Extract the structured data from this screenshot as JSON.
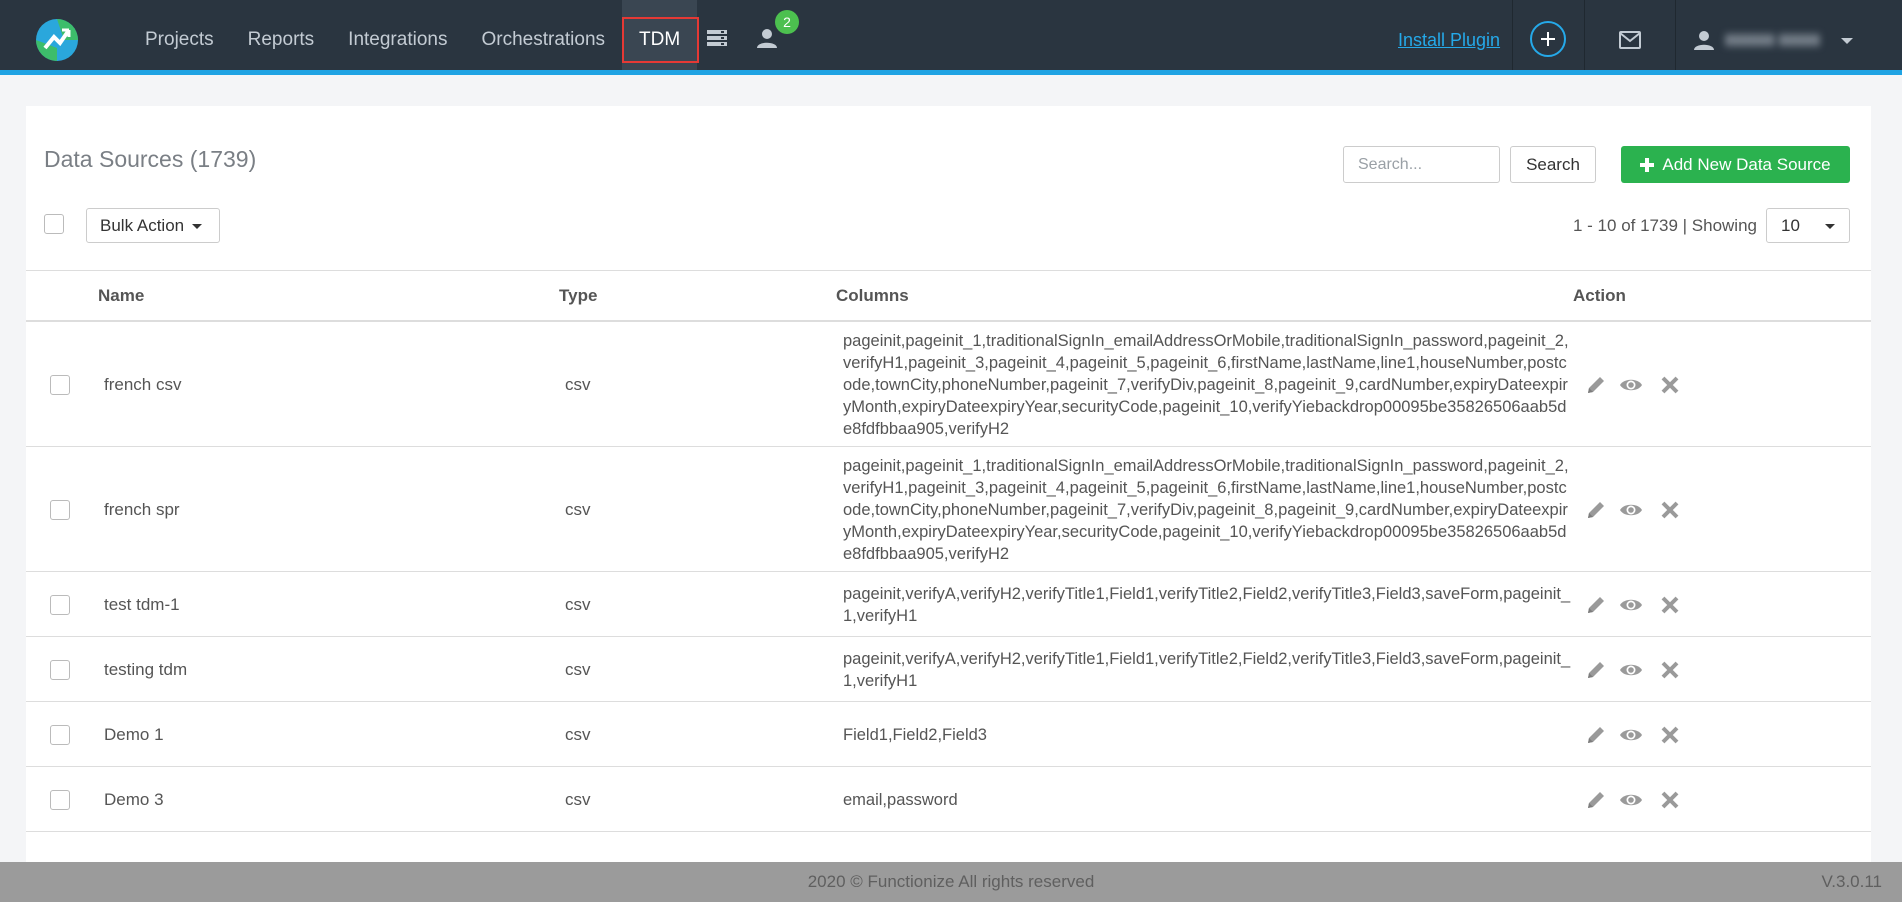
{
  "nav": {
    "links": [
      "Projects",
      "Reports",
      "Integrations",
      "Orchestrations",
      "TDM"
    ],
    "notification_count": "2",
    "install_plugin": "Install Plugin",
    "accent_color": "#1fa3e3",
    "highlight_color": "#e53935"
  },
  "main": {
    "title": "Data Sources (1739)",
    "search_placeholder": "Search...",
    "search_button": "Search",
    "add_button": "Add New Data Source",
    "bulk_action": "Bulk Action",
    "paging": "1 - 10 of 1739 | Showing",
    "page_size": "10"
  },
  "table": {
    "headers": [
      "Name",
      "Type",
      "Columns",
      "Action"
    ],
    "rows": [
      {
        "name": "french csv",
        "type": "csv",
        "columns": "pageinit,pageinit_1,traditionalSignIn_emailAddressOrMobile,traditionalSignIn_password,pageinit_2,verifyH1,pageinit_3,pageinit_4,pageinit_5,pageinit_6,firstName,lastName,line1,houseNumber,postcode,townCity,phoneNumber,pageinit_7,verifyDiv,pageinit_8,pageinit_9,cardNumber,expiryDateexpiryMonth,expiryDateexpiryYear,securityCode,pageinit_10,verifyYiebackdrop00095be35826506aab5de8fdfbbaa905,verifyH2"
      },
      {
        "name": "french spr",
        "type": "csv",
        "columns": "pageinit,pageinit_1,traditionalSignIn_emailAddressOrMobile,traditionalSignIn_password,pageinit_2,verifyH1,pageinit_3,pageinit_4,pageinit_5,pageinit_6,firstName,lastName,line1,houseNumber,postcode,townCity,phoneNumber,pageinit_7,verifyDiv,pageinit_8,pageinit_9,cardNumber,expiryDateexpiryMonth,expiryDateexpiryYear,securityCode,pageinit_10,verifyYiebackdrop00095be35826506aab5de8fdfbbaa905,verifyH2"
      },
      {
        "name": "test tdm-1",
        "type": "csv",
        "columns": "pageinit,verifyA,verifyH2,verifyTitle1,Field1,verifyTitle2,Field2,verifyTitle3,Field3,saveForm,pageinit_1,verifyH1"
      },
      {
        "name": "testing tdm",
        "type": "csv",
        "columns": "pageinit,verifyA,verifyH2,verifyTitle1,Field1,verifyTitle2,Field2,verifyTitle3,Field3,saveForm,pageinit_1,verifyH1"
      },
      {
        "name": "Demo 1",
        "type": "csv",
        "columns": "Field1,Field2,Field3"
      },
      {
        "name": "Demo 3",
        "type": "csv",
        "columns": "email,password"
      }
    ]
  },
  "footer": {
    "copyright": "2020 © Functionize All rights reserved",
    "version": "V.3.0.11"
  }
}
